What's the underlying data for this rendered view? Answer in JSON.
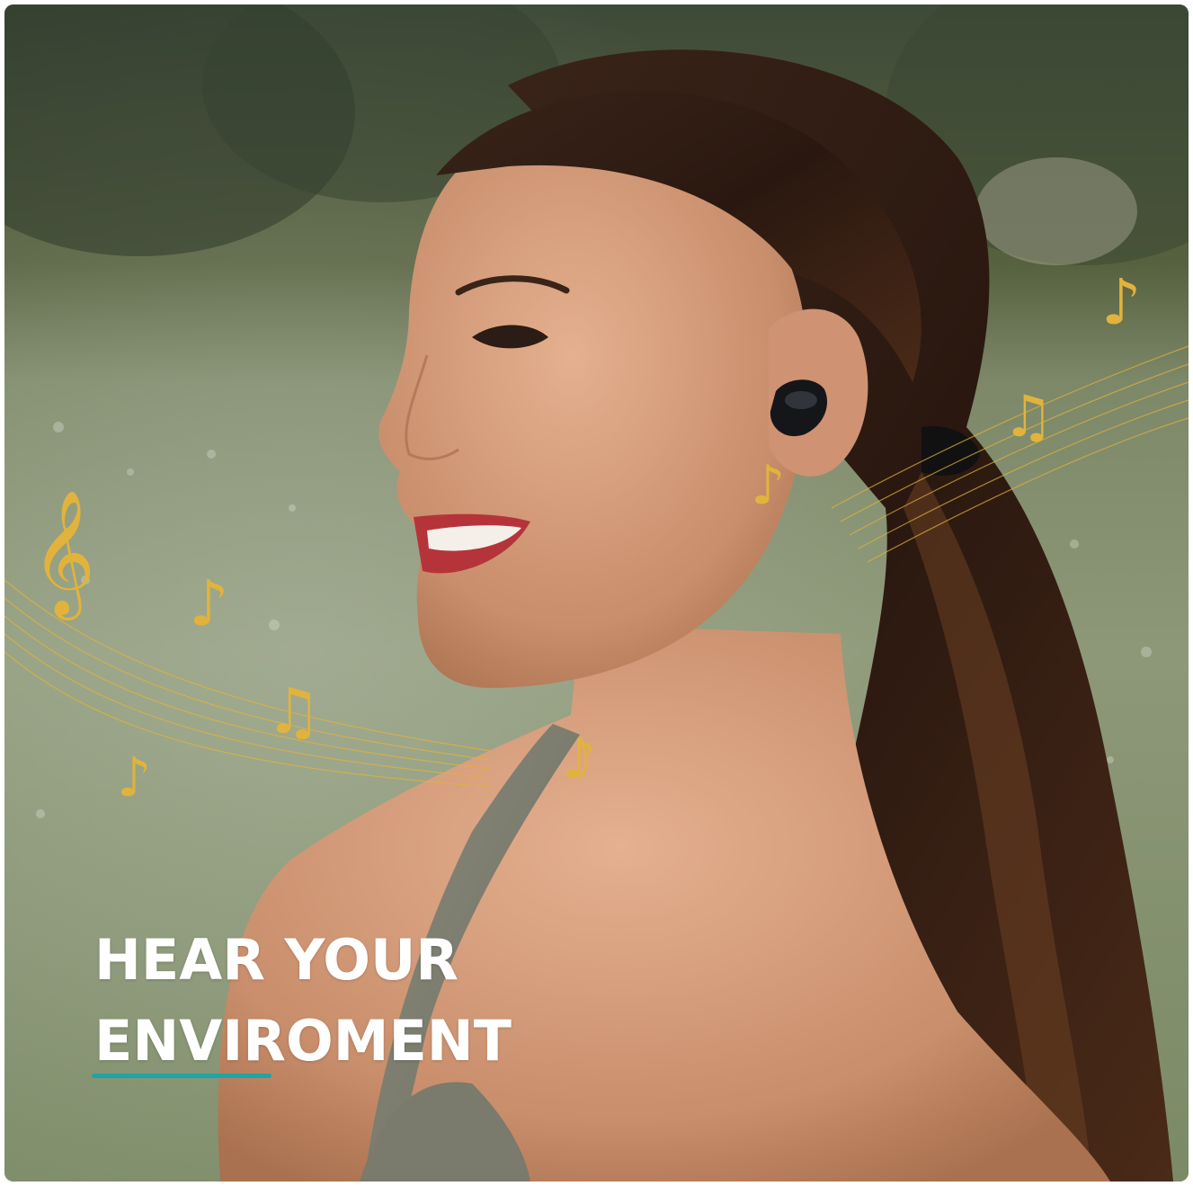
{
  "headline": {
    "line1": "HEAR YOUR",
    "line2": "ENVIROMENT"
  },
  "colors": {
    "accent_underline": "#1fa4a8",
    "note_gold": "#e2b33c",
    "headline_text": "#ffffff"
  },
  "icons": [
    "treble-clef-icon",
    "eighth-note-icon",
    "beamed-notes-icon"
  ]
}
